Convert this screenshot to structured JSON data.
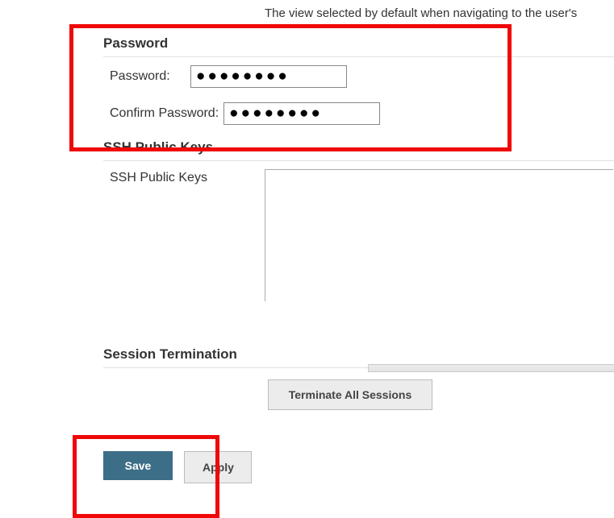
{
  "top": {
    "description": "The view selected by default when navigating to the user's"
  },
  "password_section": {
    "title": "Password",
    "password_label": "Password:",
    "password_value": "●●●●●●●●",
    "confirm_label": "Confirm Password:",
    "confirm_value": "●●●●●●●●"
  },
  "ssh_section": {
    "title": "SSH Public Keys",
    "label": "SSH Public Keys",
    "value": ""
  },
  "session_section": {
    "title": "Session Termination",
    "terminate_label": "Terminate All Sessions"
  },
  "actions": {
    "save_label": "Save",
    "apply_label": "Apply"
  }
}
